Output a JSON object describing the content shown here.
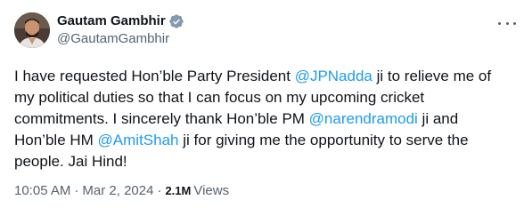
{
  "author": {
    "name": "Gautam Gambhir",
    "handle": "@GautamGambhir",
    "verified_icon": "verified-badge-icon",
    "avatar_icon": "profile-avatar"
  },
  "more_icon": "more-options-icon",
  "tweet": {
    "parts": [
      {
        "type": "text",
        "value": "I have requested Hon’ble Party President "
      },
      {
        "type": "mention",
        "value": "@JPNadda"
      },
      {
        "type": "text",
        "value": " ji to relieve me of my political duties so that I can focus on my upcoming cricket commitments. I sincerely thank Hon’ble PM "
      },
      {
        "type": "mention",
        "value": "@narendramodi"
      },
      {
        "type": "text",
        "value": " ji and Hon’ble HM "
      },
      {
        "type": "mention",
        "value": "@AmitShah"
      },
      {
        "type": "text",
        "value": " ji for giving me the opportunity to serve the people. Jai Hind!"
      }
    ]
  },
  "meta": {
    "time": "10:05 AM",
    "separator": "·",
    "date": "Mar 2, 2024",
    "views_count": "2.1M",
    "views_label": "Views"
  },
  "colors": {
    "link": "#1d9bf0",
    "text": "#0f1419",
    "secondary": "#536471",
    "verified": "#829aab"
  }
}
